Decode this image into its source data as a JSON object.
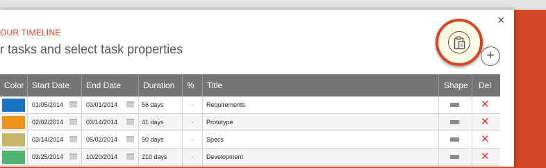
{
  "dialog": {
    "subtitle": "OUR TIMELINE",
    "heading": "r tasks and select task properties",
    "close_label": "×",
    "add_label": "+"
  },
  "table": {
    "headers": [
      "Color",
      "Start Date",
      "End Date",
      "Duration",
      "%",
      "Title",
      "Shape",
      "Del"
    ],
    "rows": [
      {
        "color": "#1a73c4",
        "start": "01/05/2014",
        "end": "03/01/2014",
        "duration": "56 days",
        "pct": "-",
        "title": "Requirements",
        "del": "✕"
      },
      {
        "color": "#f0941e",
        "start": "02/02/2014",
        "end": "03/14/2014",
        "duration": "41 days",
        "pct": "-",
        "title": "Prototype",
        "del": "✕"
      },
      {
        "color": "#c8b56a",
        "start": "03/14/2014",
        "end": "05/02/2014",
        "duration": "50 days",
        "pct": "-",
        "title": "Specs",
        "del": "✕"
      },
      {
        "color": "#4cb572",
        "start": "03/25/2014",
        "end": "10/20/2014",
        "duration": "210 days",
        "pct": "-",
        "title": "Development",
        "del": "✕"
      }
    ]
  },
  "colors": {
    "accent": "#d24726",
    "header_bg": "#757575"
  }
}
